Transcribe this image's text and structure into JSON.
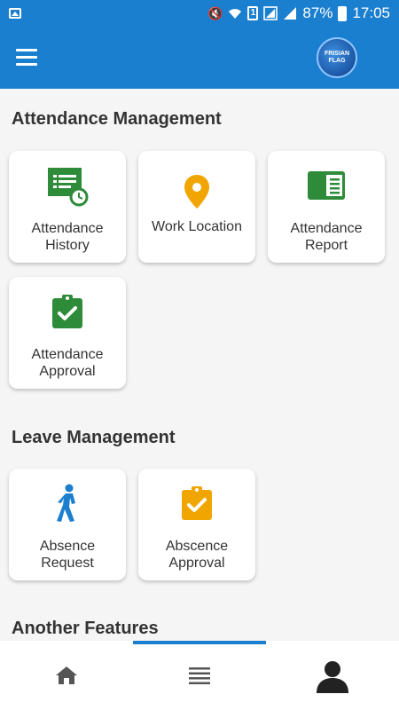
{
  "status_bar": {
    "battery": "87%",
    "time": "17:05",
    "sim": "1",
    "icons": [
      "image-icon",
      "mute-icon",
      "wifi-icon",
      "signal-icon",
      "battery-icon"
    ]
  },
  "app_bar": {
    "logo_text_line1": "FRISIAN",
    "logo_text_line2": "FLAG"
  },
  "sections": [
    {
      "title": "Attendance Management",
      "items": [
        {
          "label": "Attendance History",
          "icon": "attendance-history-icon",
          "color": "#2e8b3a"
        },
        {
          "label": "Work Location",
          "icon": "location-pin-icon",
          "color": "#f0a500"
        },
        {
          "label": "Attendance Report",
          "icon": "report-book-icon",
          "color": "#2e8b3a"
        },
        {
          "label": "Attendance Approval",
          "icon": "clipboard-check-icon",
          "color": "#2e8b3a"
        }
      ]
    },
    {
      "title": "Leave Management",
      "items": [
        {
          "label": "Absence Request",
          "icon": "walking-person-icon",
          "color": "#1b7fcf"
        },
        {
          "label": "Abscence Approval",
          "icon": "clipboard-check-icon",
          "color": "#f0a500"
        }
      ]
    },
    {
      "title": "Another Features",
      "items": []
    }
  ],
  "bottom_nav": {
    "items": [
      "home-icon",
      "list-icon",
      "profile-icon"
    ],
    "active_index": 1
  },
  "colors": {
    "primary": "#1b7fcf",
    "green": "#2e8b3a",
    "orange": "#f0a500",
    "background": "#f5f5f5"
  }
}
